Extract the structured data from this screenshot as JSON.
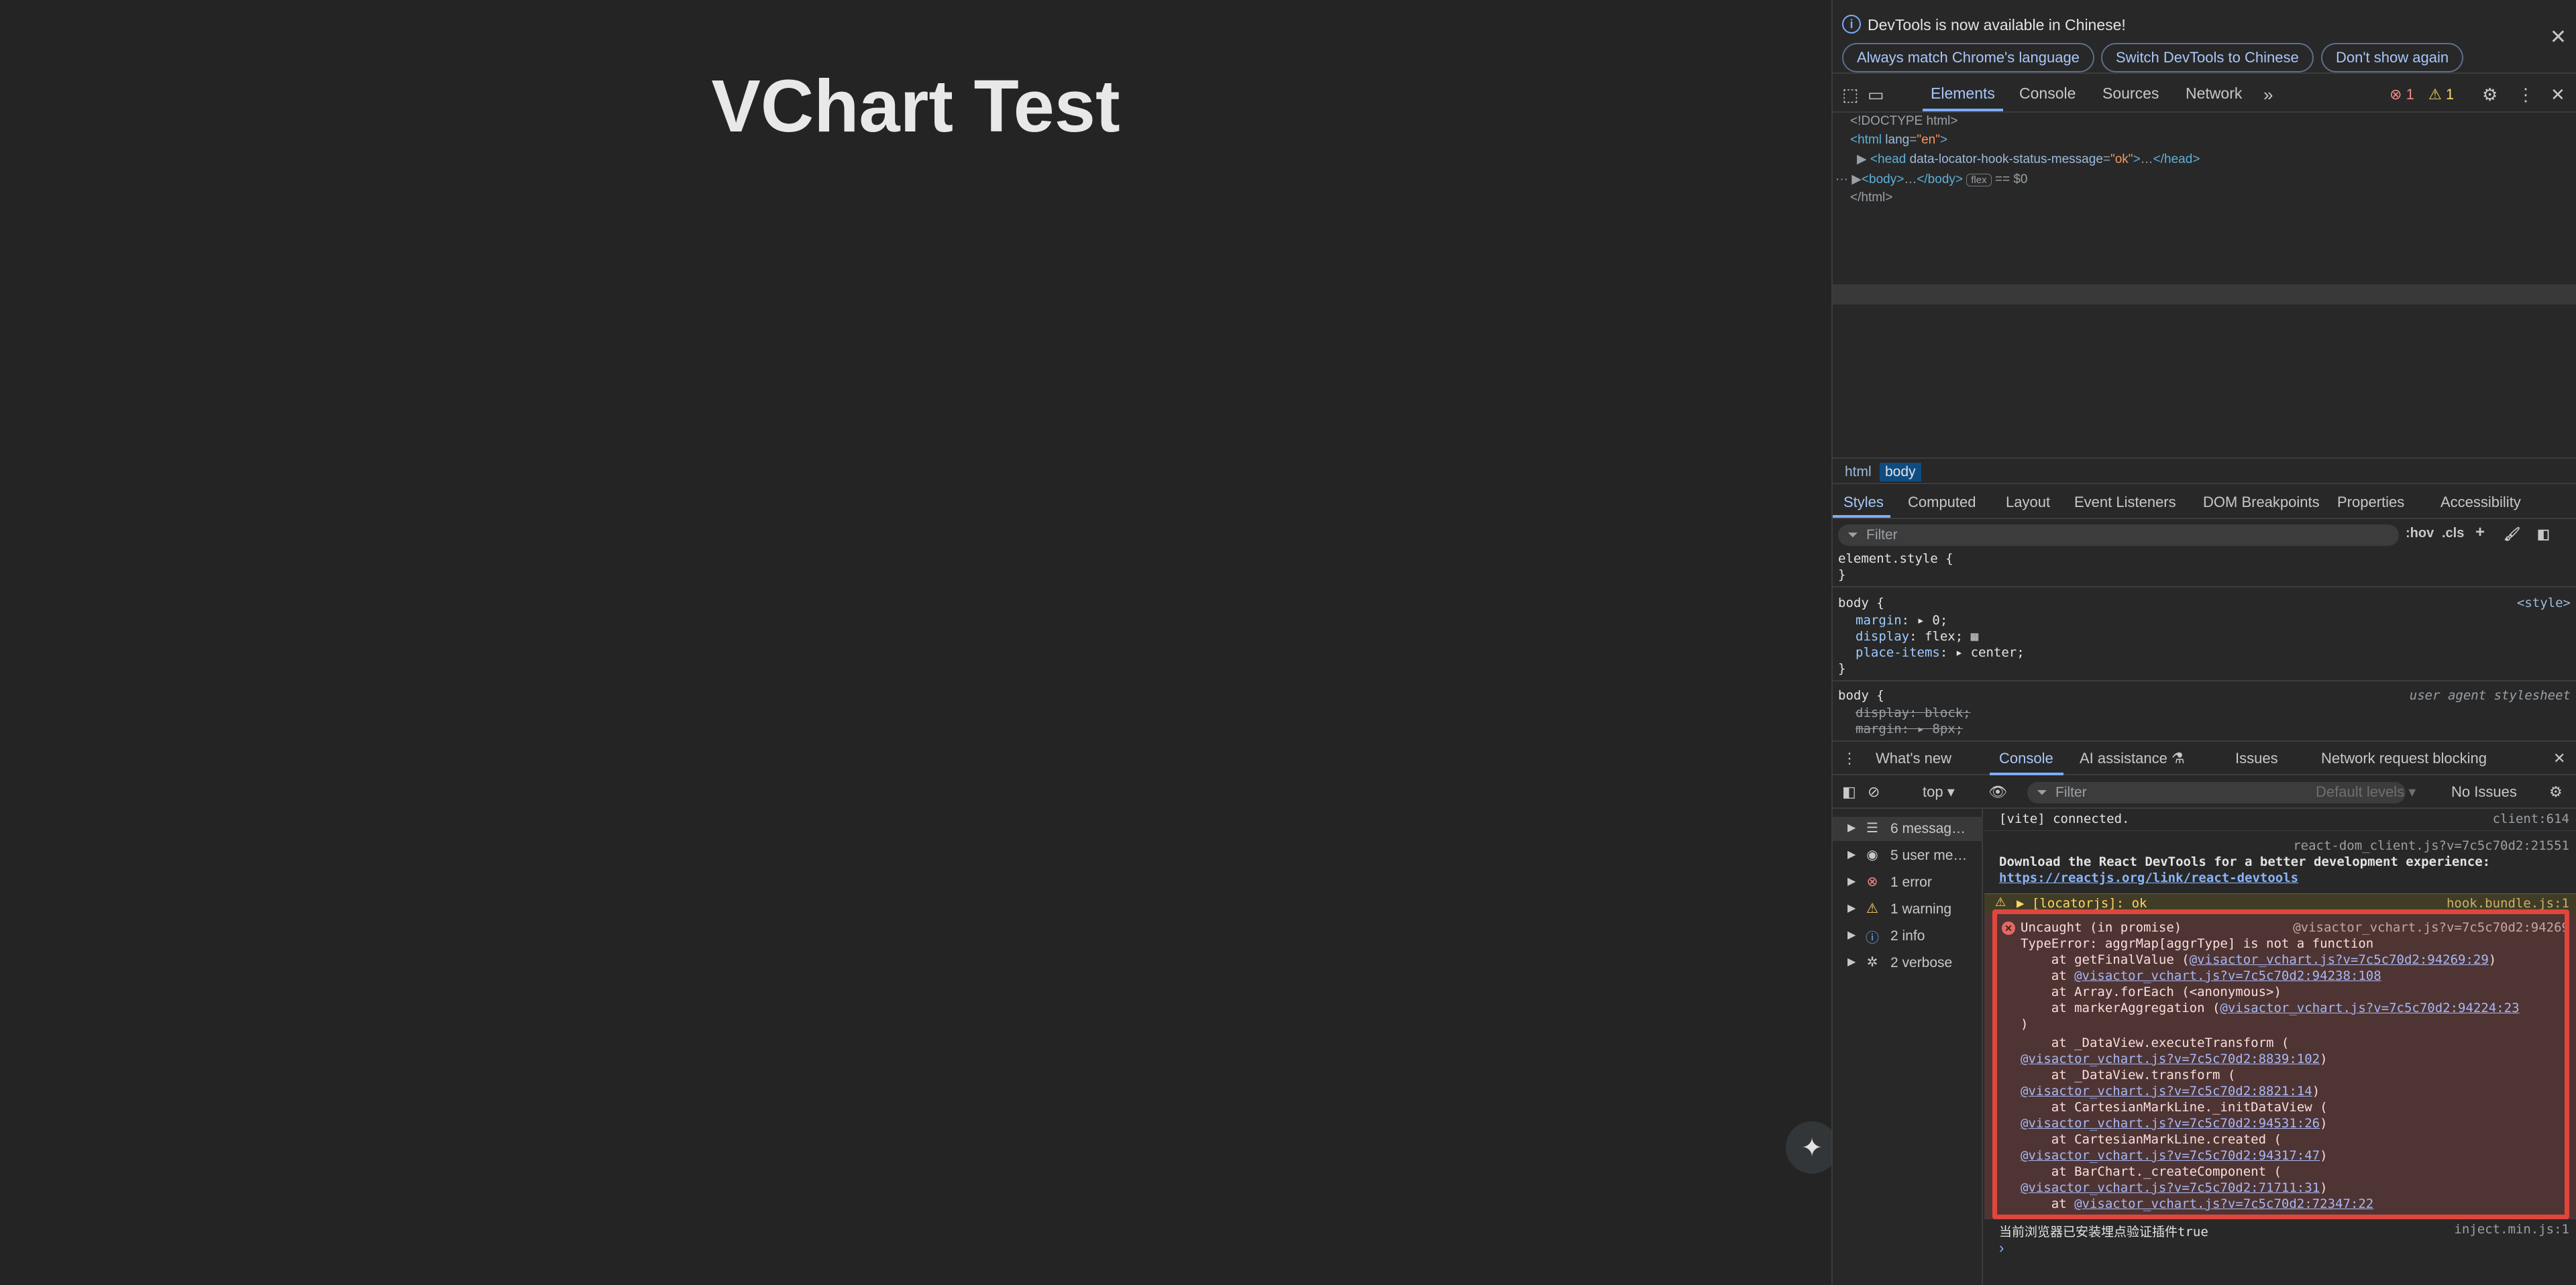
{
  "page": {
    "title": "VChart Test",
    "ai_button_icon": "sparkle-icon"
  },
  "devtools": {
    "infobar": {
      "message": "DevTools is now available in Chinese!",
      "btn_match": "Always match Chrome's language",
      "btn_switch": "Switch DevTools to Chinese",
      "btn_dont_show": "Don't show again"
    },
    "tabs": [
      "Elements",
      "Console",
      "Sources",
      "Network"
    ],
    "error_count": "1",
    "warning_count": "1",
    "dom": {
      "doctype": "<!DOCTYPE html>",
      "html_open_tag": "html",
      "html_attr_name": "lang",
      "html_attr_value": "\"en\"",
      "head_tag": "head",
      "head_attr_name": "data-locator-hook-status-message",
      "head_attr_value": "\"ok\"",
      "head_close": "</head>",
      "body_tag": "body",
      "body_close": "</body>",
      "body_badge": "flex",
      "body_eq": "== $0",
      "html_close": "</html>",
      "ellipsis": "…"
    },
    "breadcrumb": [
      "html",
      "body"
    ],
    "styles_tabs": [
      "Styles",
      "Computed",
      "Layout",
      "Event Listeners",
      "DOM Breakpoints",
      "Properties",
      "Accessibility"
    ],
    "styles_filter_placeholder": "Filter",
    "styles_hov": ":hov",
    "styles_cls": ".cls",
    "styles": {
      "element_style": "element.style {",
      "close": "}",
      "rule1_selector": "body {",
      "rule1_source": "<style>",
      "rule1_props": [
        {
          "name": "margin",
          "value": "0;"
        },
        {
          "name": "display",
          "value": "flex;"
        },
        {
          "name": "place-items",
          "value": "center;"
        }
      ],
      "rule2_selector": "body {",
      "rule2_source": "user agent stylesheet",
      "rule2_props": [
        {
          "name": "display",
          "value": "block;"
        },
        {
          "name": "margin",
          "value": "8px;"
        }
      ]
    },
    "drawer_tabs": [
      "What's new",
      "Console",
      "AI assistance",
      "Issues",
      "Network request blocking"
    ],
    "console_toolbar": {
      "context": "top",
      "filter_placeholder": "Filter",
      "levels": "Default levels",
      "issues": "No Issues"
    },
    "console_sidebar": [
      {
        "label": "6 messag…",
        "icon": "list-icon"
      },
      {
        "label": "5 user me…",
        "icon": "user-icon"
      },
      {
        "label": "1 error",
        "icon": "error-icon"
      },
      {
        "label": "1 warning",
        "icon": "warning-icon"
      },
      {
        "label": "2 info",
        "icon": "info-icon"
      },
      {
        "label": "2 verbose",
        "icon": "bug-icon"
      }
    ],
    "console_log": {
      "vite": "[vite] connected.",
      "vite_src": "client:614",
      "react_src": "react-dom_client.js?v=7c5c70d2:21551",
      "react_msg": "Download the React DevTools for a better development experience:",
      "react_link": "https://reactjs.org/link/react-devtools",
      "warn_msg": "[locatorjs]: ok",
      "warn_src": "hook.bundle.js:1",
      "err_title": "Uncaught (in promise)",
      "err_src": "@visactor_vchart.js?v=7c5c70d2:94269",
      "err_type": "TypeError: aggrMap[aggrType] is not a function",
      "err_stack": [
        {
          "pre": "    at getFinalValue (",
          "link": "@visactor_vchart.js?v=7c5c70d2:94269:29",
          "post": ")"
        },
        {
          "pre": "    at ",
          "link": "@visactor_vchart.js?v=7c5c70d2:94238:108",
          "post": ""
        },
        {
          "pre": "    at Array.forEach (<anonymous>)",
          "link": "",
          "post": ""
        },
        {
          "pre": "    at markerAggregation (",
          "link": "@visactor_vchart.js?v=7c5c70d2:94224:23",
          "post": ""
        },
        {
          "pre": ")",
          "link": "",
          "post": ""
        },
        {
          "pre": "    at _DataView.executeTransform (",
          "link": "",
          "post": ""
        },
        {
          "pre": "",
          "link": "@visactor_vchart.js?v=7c5c70d2:8839:102",
          "post": ")"
        },
        {
          "pre": "    at _DataView.transform (",
          "link": "",
          "post": ""
        },
        {
          "pre": "",
          "link": "@visactor_vchart.js?v=7c5c70d2:8821:14",
          "post": ")"
        },
        {
          "pre": "    at CartesianMarkLine._initDataView (",
          "link": "",
          "post": ""
        },
        {
          "pre": "",
          "link": "@visactor_vchart.js?v=7c5c70d2:94531:26",
          "post": ")"
        },
        {
          "pre": "    at CartesianMarkLine.created (",
          "link": "",
          "post": ""
        },
        {
          "pre": "",
          "link": "@visactor_vchart.js?v=7c5c70d2:94317:47",
          "post": ")"
        },
        {
          "pre": "    at BarChart._createComponent (",
          "link": "",
          "post": ""
        },
        {
          "pre": "",
          "link": "@visactor_vchart.js?v=7c5c70d2:71711:31",
          "post": ")"
        },
        {
          "pre": "    at ",
          "link": "@visactor_vchart.js?v=7c5c70d2:72347:22",
          "post": ""
        }
      ],
      "inject_msg": "当前浏览器已安装埋点验证插件true",
      "inject_src": "inject.min.js:1"
    }
  }
}
